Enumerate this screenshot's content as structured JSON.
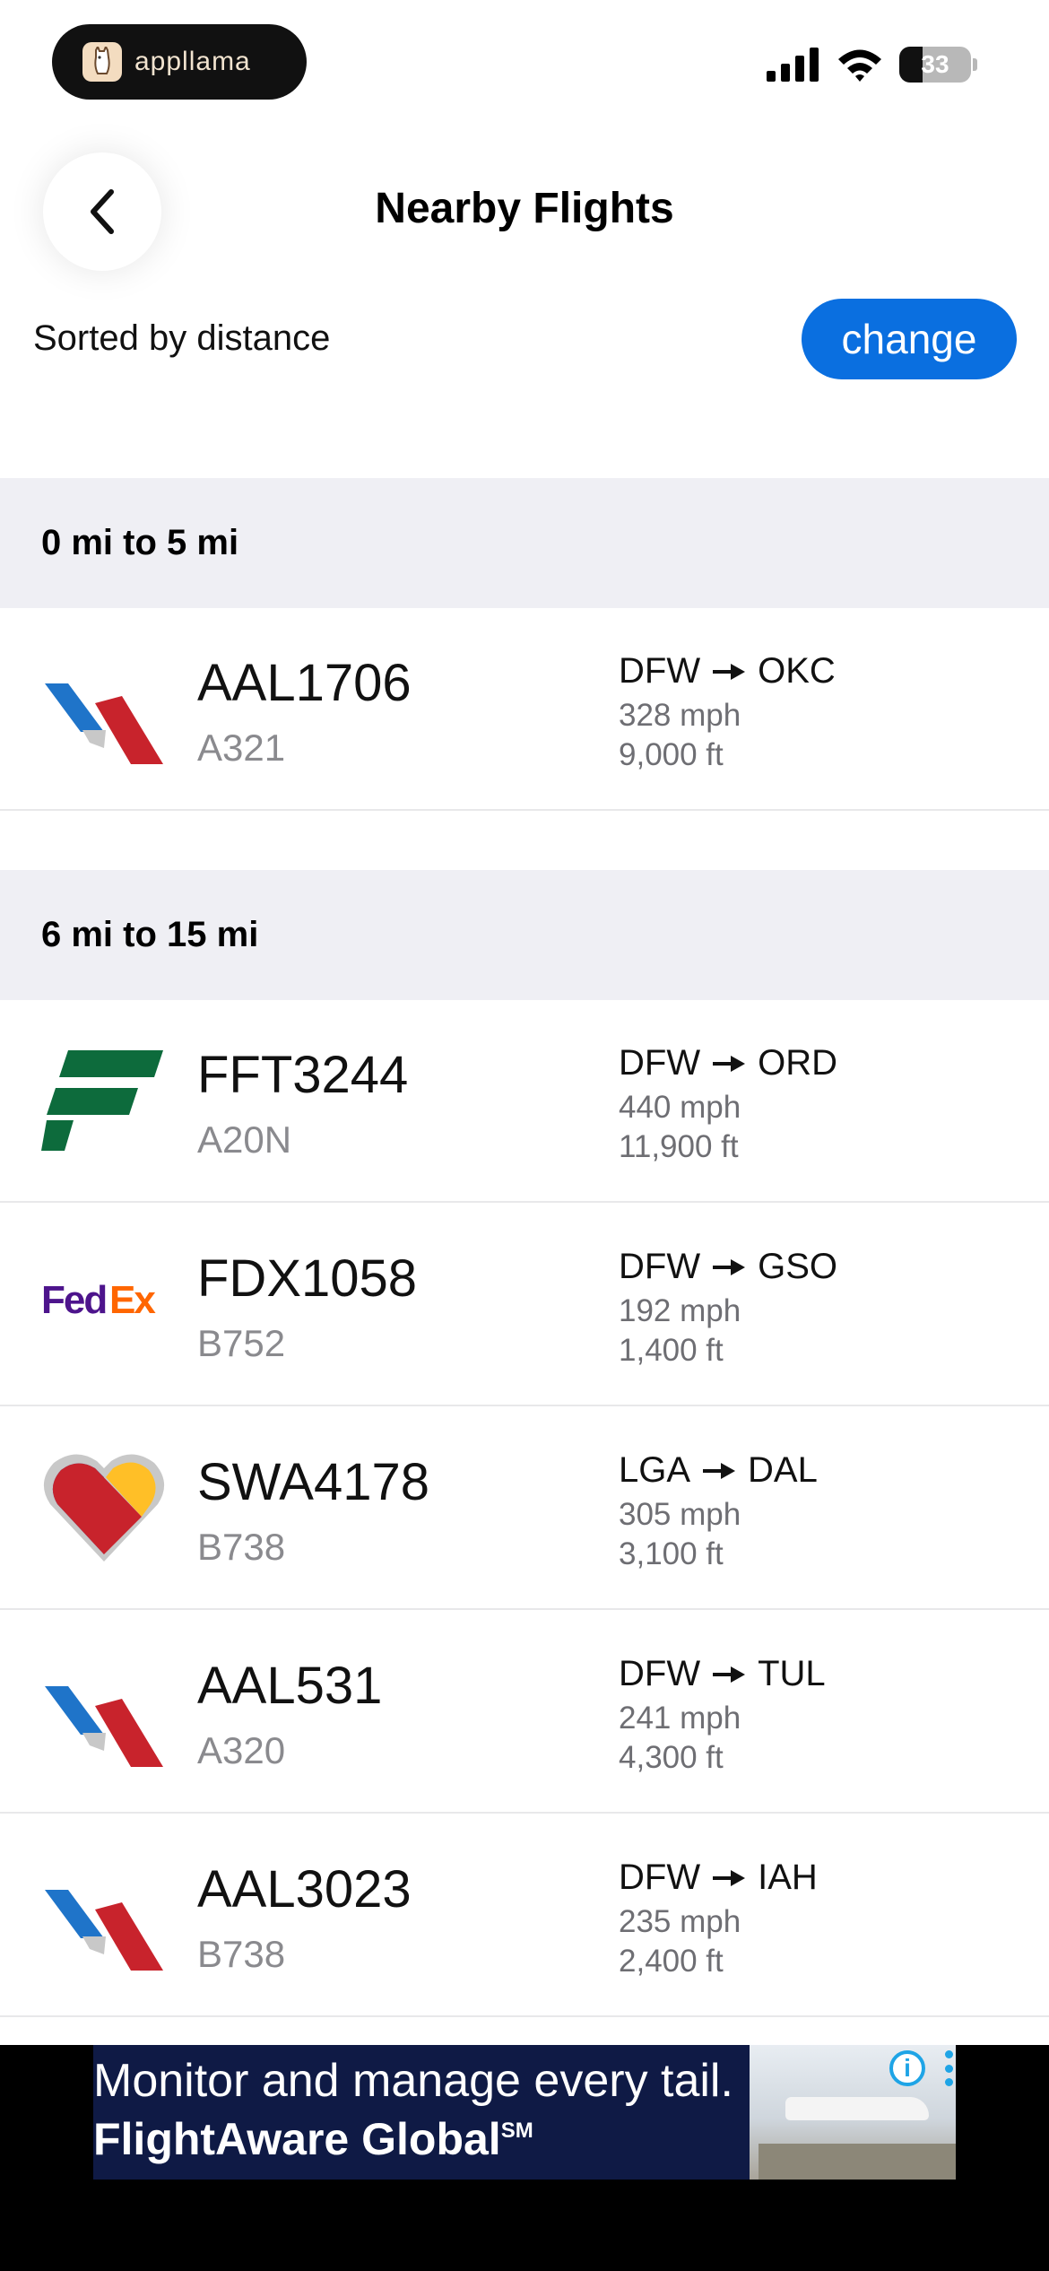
{
  "status_bar": {
    "app_badge": "appllama",
    "battery": "33"
  },
  "header": {
    "title": "Nearby Flights",
    "sort_label": "Sorted by distance",
    "change_label": "change"
  },
  "sections": [
    {
      "title": "0 mi to 5 mi",
      "flights": [
        {
          "callsign": "AAL1706",
          "aircraft": "A321",
          "from": "DFW",
          "to": "OKC",
          "speed": "328 mph",
          "altitude": "9,000 ft",
          "airline_logo": "american-airlines-logo"
        }
      ]
    },
    {
      "title": "6 mi to 15 mi",
      "flights": [
        {
          "callsign": "FFT3244",
          "aircraft": "A20N",
          "from": "DFW",
          "to": "ORD",
          "speed": "440 mph",
          "altitude": "11,900 ft",
          "airline_logo": "frontier-logo"
        },
        {
          "callsign": "FDX1058",
          "aircraft": "B752",
          "from": "DFW",
          "to": "GSO",
          "speed": "192 mph",
          "altitude": "1,400 ft",
          "airline_logo": "fedex-logo"
        },
        {
          "callsign": "SWA4178",
          "aircraft": "B738",
          "from": "LGA",
          "to": "DAL",
          "speed": "305 mph",
          "altitude": "3,100 ft",
          "airline_logo": "southwest-heart-logo"
        },
        {
          "callsign": "AAL531",
          "aircraft": "A320",
          "from": "DFW",
          "to": "TUL",
          "speed": "241 mph",
          "altitude": "4,300 ft",
          "airline_logo": "american-airlines-logo"
        },
        {
          "callsign": "AAL3023",
          "aircraft": "B738",
          "from": "DFW",
          "to": "IAH",
          "speed": "235 mph",
          "altitude": "2,400 ft",
          "airline_logo": "american-airlines-logo"
        }
      ]
    }
  ],
  "ad": {
    "line1": "Monitor and manage every tail.",
    "line2": "FlightAware Global",
    "line2_mark": "SM"
  },
  "colors": {
    "accent": "#0a6fe0",
    "section_bg": "#efeff4"
  }
}
